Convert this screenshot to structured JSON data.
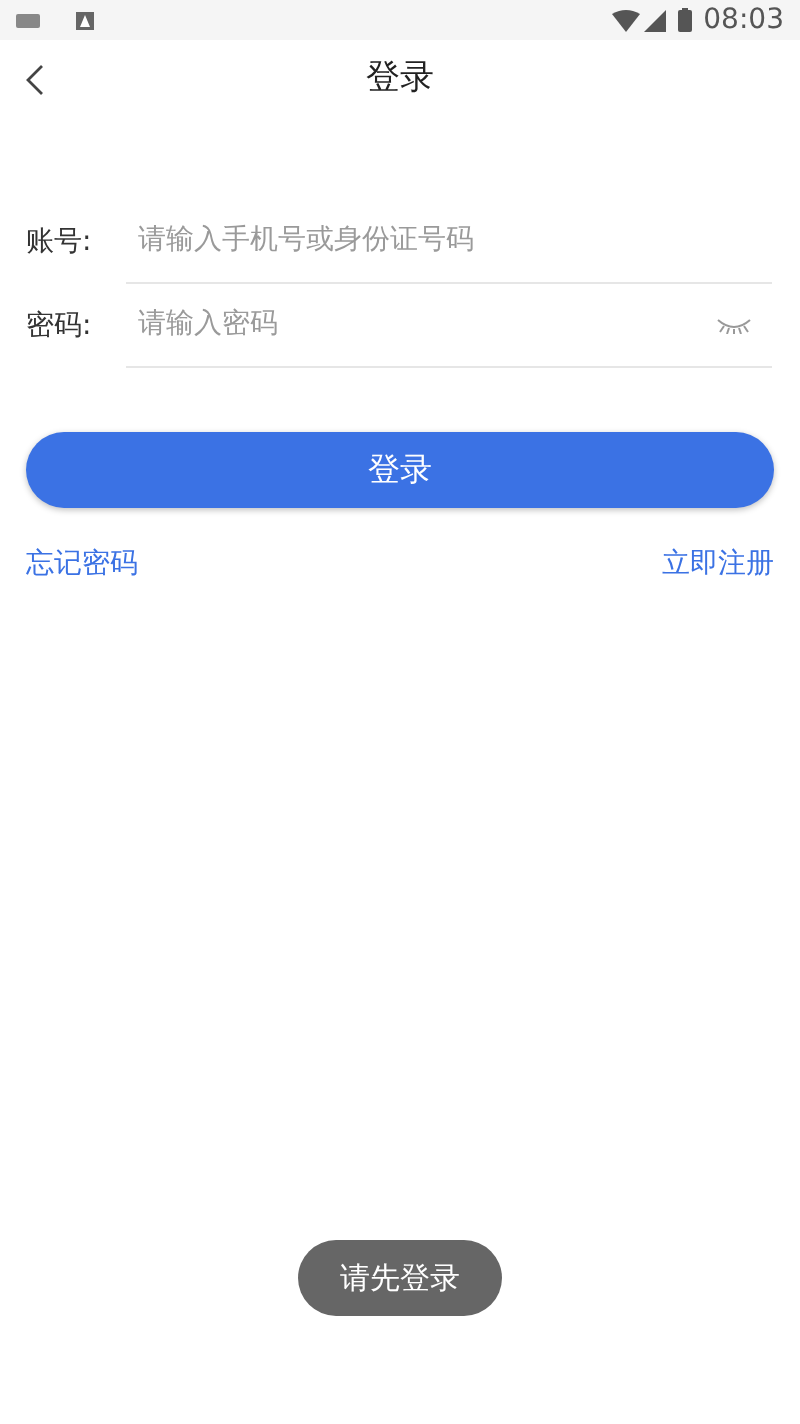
{
  "status_bar": {
    "time": "08:03"
  },
  "header": {
    "title": "登录"
  },
  "fields": [
    {
      "label": "账号:",
      "placeholder": "请输入手机号或身份证号码",
      "kind": "text"
    },
    {
      "label": "密码:",
      "placeholder": "请输入密码",
      "kind": "password"
    }
  ],
  "login_button": "登录",
  "links": [
    "忘记密码",
    "立即注册"
  ],
  "toast": "请先登录"
}
